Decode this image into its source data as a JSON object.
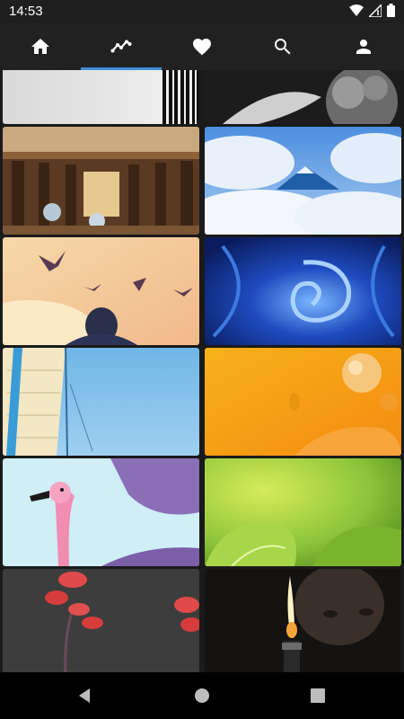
{
  "status_bar": {
    "time": "14:53",
    "icons": [
      "wifi-icon",
      "signal-icon",
      "battery-icon"
    ]
  },
  "top_nav": {
    "active_tab": "trending",
    "accent_color": "#3f8fd8",
    "tabs": [
      {
        "id": "home",
        "icon": "home-icon"
      },
      {
        "id": "trending",
        "icon": "trending-icon"
      },
      {
        "id": "favorites",
        "icon": "heart-icon"
      },
      {
        "id": "search",
        "icon": "search-icon"
      },
      {
        "id": "profile",
        "icon": "person-icon"
      }
    ]
  },
  "wallpapers": [
    {
      "subject": "abstract-gray-stripes"
    },
    {
      "subject": "black-white-foliage"
    },
    {
      "subject": "baroque-library"
    },
    {
      "subject": "mountain-peak-above-clouds"
    },
    {
      "subject": "boy-watching-birds"
    },
    {
      "subject": "blue-swirl"
    },
    {
      "subject": "blue-sailboat-sail"
    },
    {
      "subject": "orange-cheese-abstract"
    },
    {
      "subject": "pink-flamingo"
    },
    {
      "subject": "green-leaves"
    },
    {
      "subject": "red-flowers-gray"
    },
    {
      "subject": "candle-flame-face"
    }
  ],
  "system_nav": {
    "buttons": [
      "back-icon",
      "home-circle-icon",
      "recents-icon"
    ]
  }
}
